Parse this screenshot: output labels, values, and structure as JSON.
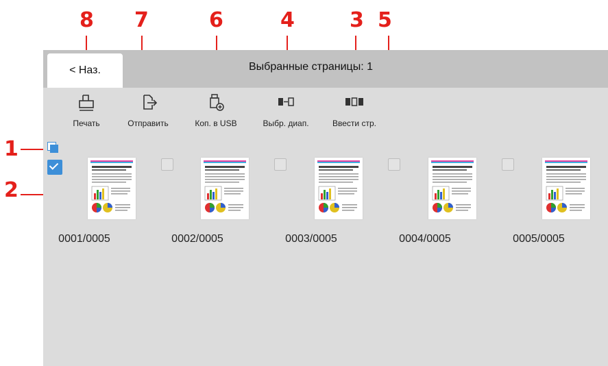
{
  "callouts": {
    "c1": "1",
    "c2": "2",
    "c3": "3",
    "c4": "4",
    "c5": "5",
    "c6": "6",
    "c7": "7",
    "c8": "8"
  },
  "header": {
    "back_label": "< Наз.",
    "title": "Выбранные страницы: 1"
  },
  "toolbar": [
    {
      "label": "Печать",
      "icon": "print-icon"
    },
    {
      "label": "Отправить",
      "icon": "send-icon"
    },
    {
      "label": "Коп. в USB",
      "icon": "usb-copy-icon"
    },
    {
      "label": "Выбр. диап.",
      "icon": "range-select-icon"
    },
    {
      "label": "Ввести стр.",
      "icon": "page-entry-icon"
    }
  ],
  "pages": [
    {
      "name": "0001/0005",
      "selected": true
    },
    {
      "name": "0002/0005",
      "selected": false
    },
    {
      "name": "0003/0005",
      "selected": false
    },
    {
      "name": "0004/0005",
      "selected": false
    },
    {
      "name": "0005/0005",
      "selected": false
    }
  ],
  "colors": {
    "callout": "#e4201b",
    "checkbox_on": "#3d8fd8",
    "header_bg": "#c2c2c2",
    "screen_bg": "#dcdcdc"
  }
}
